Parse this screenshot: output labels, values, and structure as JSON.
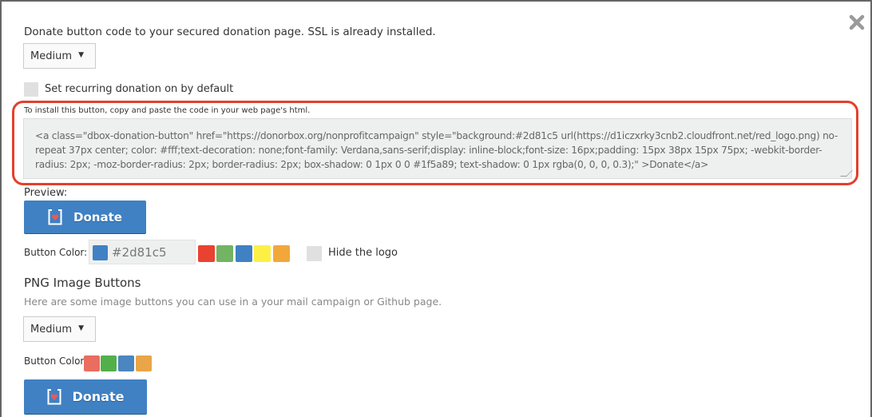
{
  "intro_text": "Donate button code to your secured donation page. SSL is already installed.",
  "size_select": {
    "value": "Medium"
  },
  "recurring_checkbox": {
    "label": "Set recurring donation on by default",
    "checked": false
  },
  "install_note": "To install this button, copy and paste the code in your web page's html.",
  "code": "<a class=\"dbox-donation-button\" href=\"https://donorbox.org/nonprofitcampaign\" style=\"background:#2d81c5 url(https://d1iczxrky3cnb2.cloudfront.net/red_logo.png) no-repeat 37px center; color: #fff;text-decoration: none;font-family: Verdana,sans-serif;display: inline-block;font-size: 16px;padding: 15px 38px 15px 75px; -webkit-border-radius: 2px; -moz-border-radius: 2px; border-radius: 2px; box-shadow: 0 1px 0 0 #1f5a89; text-shadow: 0 1px rgba(0, 0, 0, 0.3);\" >Donate</a>",
  "preview": {
    "label": "Preview:",
    "button_label": "Donate",
    "button_color_label": "Button Color:",
    "color_value": "#2d81c5",
    "swatches": [
      "#e94230",
      "#72b364",
      "#3f81c3",
      "#fdf045",
      "#f2a73b"
    ],
    "hide_logo": {
      "label": "Hide the logo",
      "checked": false
    }
  },
  "png_section": {
    "title": "PNG Image Buttons",
    "description": "Here are some image buttons you can use in a your mail campaign or Github page.",
    "size_select": {
      "value": "Medium"
    },
    "button_color_label": "Button Color:",
    "swatches": [
      "#ea6d60",
      "#52b04a",
      "#4b86c1",
      "#eaa548"
    ],
    "button_label": "Donate"
  },
  "colors": {
    "highlight": "#e2402c",
    "button_blue": "#3f81c3"
  }
}
